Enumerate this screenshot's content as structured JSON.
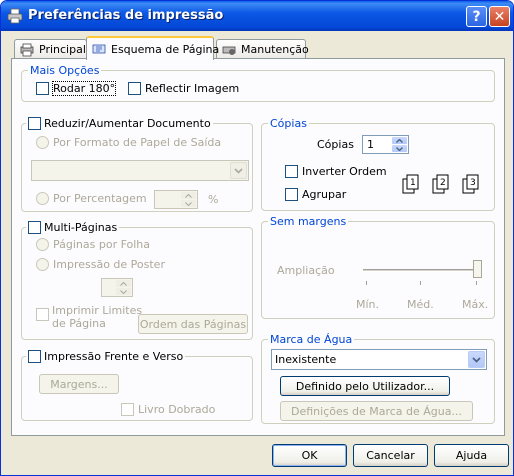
{
  "window": {
    "title": "Preferências de impressão",
    "help_label": "?",
    "close_label": "✕"
  },
  "tabs": [
    {
      "label": "Principal",
      "active": false
    },
    {
      "label": "Esquema de Página",
      "active": true
    },
    {
      "label": "Manutenção",
      "active": false
    }
  ],
  "mais_opcoes": {
    "legend": "Mais Opções",
    "rodar_label": "Rodar 180°",
    "reflectir_label": "Reflectir Imagem"
  },
  "reduzir": {
    "legend": "Reduzir/Aumentar Documento",
    "por_formato_label": "Por Formato de Papel de Saída",
    "por_formato_value": "",
    "por_percentagem_label": "Por Percentagem",
    "percent_value": "",
    "percent_unit": "%"
  },
  "multi_paginas": {
    "legend": "Multi-Páginas",
    "paginas_por_folha_label": "Páginas por Folha",
    "impressao_poster_label": "Impressão de Poster",
    "poster_value": "",
    "imprimir_limites_label_1": "Imprimir Limites",
    "imprimir_limites_label_2": "de Página",
    "ordem_button": "Ordem das Páginas"
  },
  "frente_verso": {
    "legend": "Impressão Frente e Verso",
    "margens_button": "Margens...",
    "livro_dobrado_label": "Livro Dobrado"
  },
  "copias": {
    "legend": "Cópias",
    "copias_label": "Cópias",
    "copias_value": "1",
    "inverter_label": "Inverter Ordem",
    "agrupar_label": "Agrupar",
    "collate_icons": [
      "1",
      "2",
      "3"
    ]
  },
  "sem_margens": {
    "legend": "Sem margens",
    "ampliacao_label": "Ampliação",
    "slider_level": 1.0,
    "ticks": [
      "Mín.",
      "Méd.",
      "Máx."
    ]
  },
  "marca_agua": {
    "legend": "Marca de Água",
    "selected": "Inexistente",
    "definido_button": "Definido pelo Utilizador...",
    "definicoes_button": "Definições de Marca de Água..."
  },
  "footer": {
    "ok": "OK",
    "cancelar": "Cancelar",
    "ajuda": "Ajuda"
  }
}
